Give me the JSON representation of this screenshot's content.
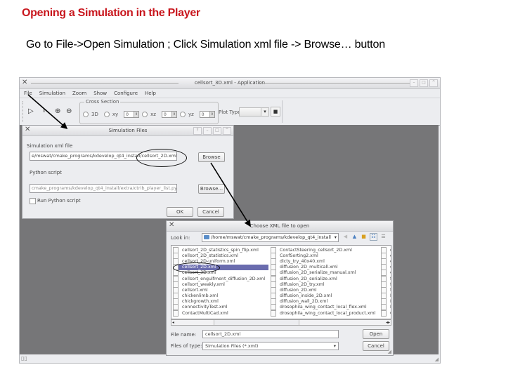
{
  "slide": {
    "title": "Opening a Simulation in the Player",
    "instruction": "Go to File->Open Simulation ; Click Simulation xml file -> Browse… button",
    "title_color": "#c8161d"
  },
  "app_window": {
    "title": "cellsort_3D.xml - Application",
    "close_glyph": "✕",
    "window_buttons": [
      "–",
      "□",
      "^"
    ],
    "menu": [
      "File",
      "Simulation",
      "Zoom",
      "Show",
      "Configure",
      "Help"
    ],
    "toolbar": {
      "play_glyph": "▷",
      "pause_glyph": "⏸",
      "zoom_in_glyph": "⊕",
      "zoom_out_glyph": "⊖",
      "cross_section_label": "Cross Section",
      "radio_3d": "3D",
      "radio_xy": "xy",
      "xy_value": "0",
      "radio_xz": "xz",
      "xz_value": "0",
      "radio_yz": "yz",
      "yz_value": "0",
      "plot_type_label": "Plot Type",
      "plot_type_value": "",
      "camera_glyph": "📷"
    },
    "canvas_color": "#767678"
  },
  "simulation_files_dialog": {
    "title": "Simulation Files",
    "close_glyph": "✕",
    "window_buttons": [
      "?",
      "–",
      "□",
      "^"
    ],
    "sim_xml_label": "Simulation xml file",
    "sim_xml_value": "e/mswat/cmake_programs/kdevelop_qt4_install/cellsort_2D.xml",
    "browse_label": "Browse",
    "python_label": "Python script",
    "python_value": "cmake_programs/kdevelop_qt4_install/extra/ctrib_player_list.py",
    "browse2_label": "Browse...",
    "run_python_label": "Run Python script",
    "run_python_checked": false,
    "ok_label": "OK",
    "cancel_label": "Cancel"
  },
  "choose_xml_dialog": {
    "title": "Choose XML file to open",
    "close_glyph": "✕",
    "look_in_label": "Look in:",
    "look_in_value": "/home/mswat/cmake_programs/kdevelop_qt4_install",
    "files_col1": [
      "cellsort_2D_statistics_spin_flip.xml",
      "cellsort_2D_statistics.xml",
      "cellsort_2D-uniform.xml",
      "cellsort_2D.xml",
      "cellsort_3D.xml",
      "cellsort_engulfment_diffusion_2D.xml",
      "cellsort_weakly.xml",
      "cellsort.xml",
      "chickenlimb.xml",
      "chickgrowth.xml",
      "connectivityTest.xml",
      "ContactMultiCad.xml"
    ],
    "files_col2": [
      "ContactSteering_cellsort_2D.xml",
      "ConfSorting2.xml",
      "dicty_try_40x40.xml",
      "diffusion_2D_multicall.xml",
      "diffusion_2D_serialize_manual.xml",
      "diffusion_2D_serialize.xml",
      "diffusion_2D_try.xml",
      "diffusion_2D.xml",
      "diffusion_inside_2D.xml",
      "diffusion_wall_2D.xml",
      "drosophila_wing_contact_local_flex.xml",
      "drosophila_wing_contact_local_product.xml"
    ],
    "files_col3": [
      "d",
      "d",
      "e",
      "e",
      "e",
      "fl",
      "fl",
      "fl",
      "F",
      "F",
      "F",
      "G"
    ],
    "selected_file": "cellsort_2D.xml",
    "file_name_label": "File name:",
    "file_name_value": "cellsort_2D.xml",
    "files_of_type_label": "Files of type:",
    "files_of_type_value": "Simulation Files (*.xml)",
    "open_label": "Open",
    "cancel_label": "Cancel",
    "selection_color": "#6a6cae"
  }
}
